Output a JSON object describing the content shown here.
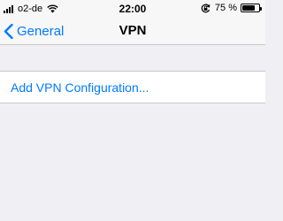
{
  "status_bar": {
    "carrier": "o2-de",
    "time": "22:00",
    "battery_text": "75 %",
    "battery_level": 0.75,
    "icons": [
      "signal-icon",
      "wifi-icon",
      "rotation-lock-icon",
      "battery-icon"
    ]
  },
  "nav": {
    "back_label": "General",
    "title": "VPN"
  },
  "list": {
    "add_label": "Add VPN Configuration..."
  },
  "colors": {
    "accent": "#007aff",
    "background": "#efeff4",
    "bar": "#f7f7f7"
  }
}
